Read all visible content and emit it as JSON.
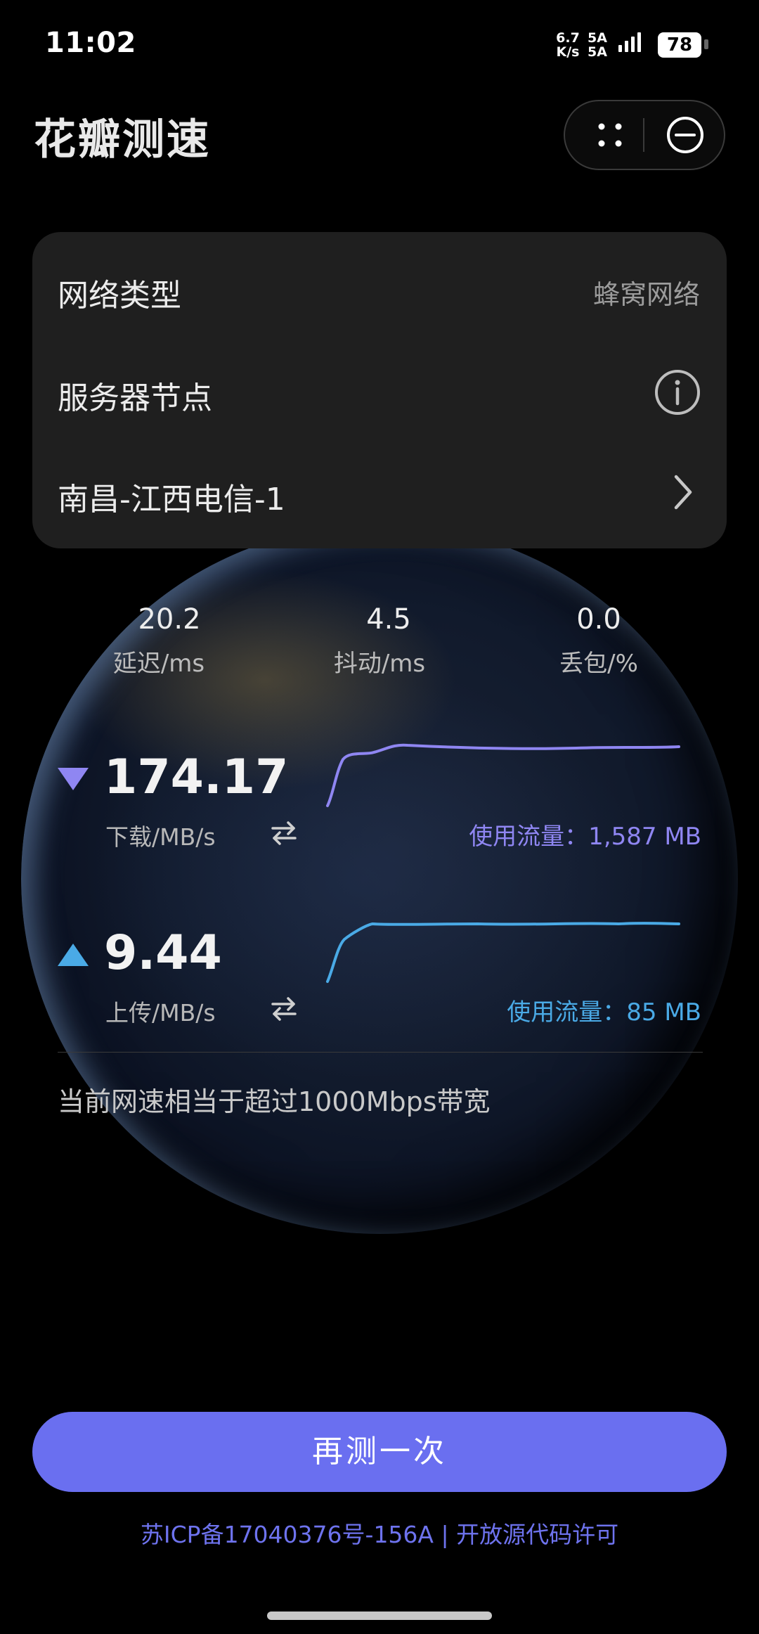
{
  "status_bar": {
    "time": "11:02",
    "net_speed_value": "6.7",
    "net_speed_unit": "K/s",
    "signal_1": "5A",
    "signal_2": "5A",
    "battery": "78"
  },
  "app": {
    "title": "花瓣测速"
  },
  "info_card": {
    "network_type_label": "网络类型",
    "network_type_value": "蜂窝网络",
    "server_node_label": "服务器节点",
    "server_name": "南昌-江西电信-1"
  },
  "metrics": [
    {
      "value": "20.2",
      "label": "延迟/ms"
    },
    {
      "value": "4.5",
      "label": "抖动/ms"
    },
    {
      "value": "0.0",
      "label": "丢包/%"
    }
  ],
  "download": {
    "value": "174.17",
    "label": "下载/MB/s",
    "usage": "使用流量：1,587 MB",
    "color": "#8f86f2",
    "icon": "triangle-down-icon"
  },
  "upload": {
    "value": "9.44",
    "label": "上传/MB/s",
    "usage": "使用流量：85 MB",
    "color": "#4aaae6",
    "icon": "triangle-up-icon"
  },
  "bandwidth_note": "当前网速相当于超过1000Mbps带宽",
  "retest_button": "再测一次",
  "footer": "苏ICP备17040376号-156A | 开放源代码许可",
  "colors": {
    "accent": "#6a6ff0",
    "card_bg": "#1f1f1f"
  }
}
